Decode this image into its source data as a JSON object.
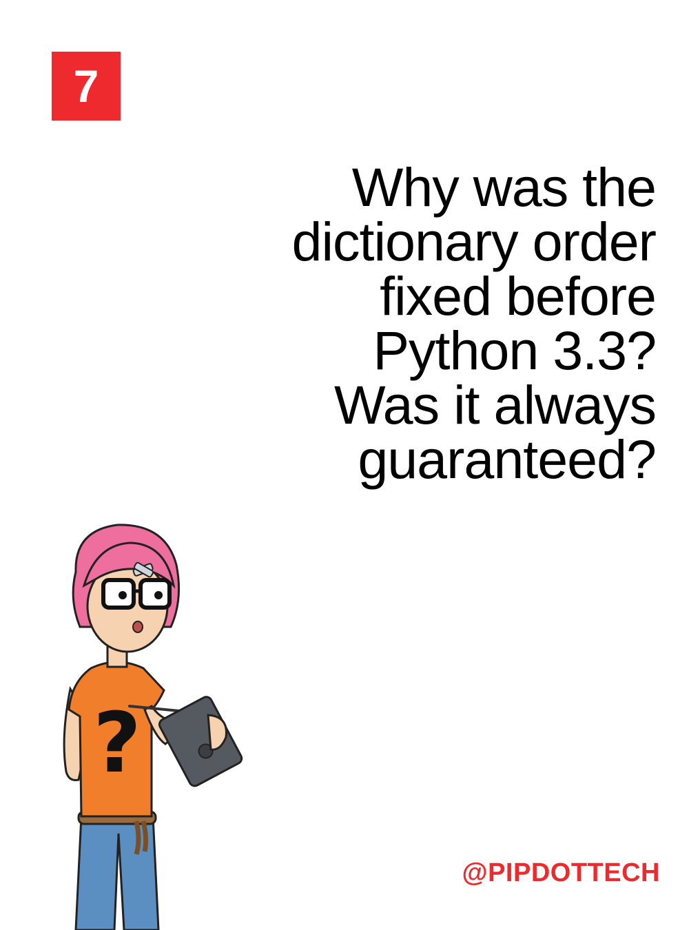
{
  "badge": {
    "number": "7"
  },
  "question": {
    "lines": [
      "Why was the",
      "dictionary order",
      "fixed before",
      "Python 3.3?",
      "Was it always",
      "guaranteed?"
    ]
  },
  "footer": {
    "handle": "@PIPDOTTECH"
  },
  "illustration": {
    "icon": "cartoon-character-with-tablet"
  },
  "colors": {
    "accent": "#ee2a2e",
    "text": "#000000",
    "background": "#ffffff",
    "hair": "#ee6e9e",
    "shirt": "#f07e2a",
    "jeans": "#5b8fc2",
    "skin": "#f6d2b0",
    "tablet": "#555a60"
  }
}
